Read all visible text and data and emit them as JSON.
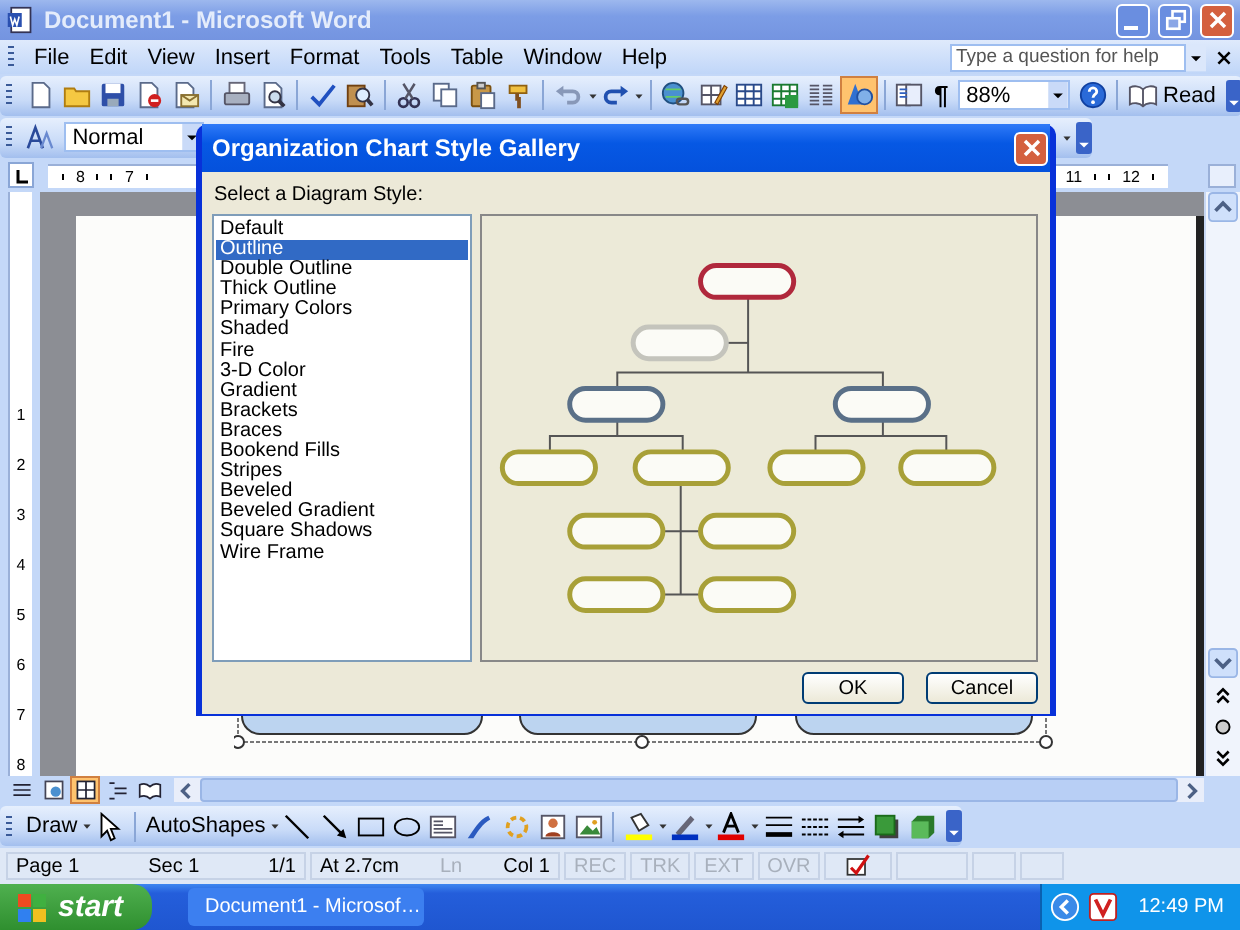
{
  "window": {
    "title": "Document1 - Microsoft Word"
  },
  "menu": [
    "File",
    "Edit",
    "View",
    "Insert",
    "Format",
    "Tools",
    "Table",
    "Window",
    "Help"
  ],
  "help_box": {
    "placeholder": "Type a question for help"
  },
  "standard_toolbar": {
    "drawing_toggle_on": true,
    "show_marks": "¶",
    "zoom": "88%",
    "read_button": "Read"
  },
  "formatting_toolbar": {
    "style": "Normal"
  },
  "horizontal_ruler": {
    "left_labels": [
      "8",
      "7"
    ],
    "right_labels": [
      "11",
      "12"
    ]
  },
  "vertical_ruler": [
    "1",
    "2",
    "3",
    "4",
    "5",
    "6",
    "7",
    "8"
  ],
  "view_buttons": [
    {
      "selected": false
    },
    {
      "selected": false
    },
    {
      "selected": true
    },
    {
      "selected": false
    },
    {
      "selected": false
    }
  ],
  "dialog": {
    "title": "Organization Chart Style Gallery",
    "prompt": "Select a Diagram Style:",
    "styles": [
      {
        "label": "Default",
        "selected": false
      },
      {
        "label": "Outline",
        "selected": true
      },
      {
        "label": "Double Outline",
        "selected": false
      },
      {
        "label": "Thick Outline",
        "selected": false
      },
      {
        "label": "Primary Colors",
        "selected": false
      },
      {
        "label": "Shaded",
        "selected": false
      },
      {
        "label": "Fire",
        "selected": false
      },
      {
        "label": "3-D Color",
        "selected": false
      },
      {
        "label": "Gradient",
        "selected": false
      },
      {
        "label": "Brackets",
        "selected": false
      },
      {
        "label": "Braces",
        "selected": false
      },
      {
        "label": "Bookend Fills",
        "selected": false
      },
      {
        "label": "Stripes",
        "selected": false
      },
      {
        "label": "Beveled",
        "selected": false
      },
      {
        "label": "Beveled Gradient",
        "selected": false
      },
      {
        "label": "Square Shadows",
        "selected": false
      },
      {
        "label": "Wire Frame",
        "selected": false
      }
    ],
    "buttons": [
      "OK",
      "Cancel"
    ]
  },
  "drawing_toolbar": {
    "draw": "Draw",
    "autoshapes": "AutoShapes"
  },
  "status_bar": {
    "sections": [
      {
        "fields": [
          {
            "text": "Page 1",
            "disabled": false
          },
          {
            "text": "Sec 1",
            "disabled": false
          },
          {
            "text": "1/1",
            "disabled": false
          }
        ]
      },
      {
        "fields": [
          {
            "text": "At 2.7cm",
            "disabled": false
          },
          {
            "text": "Ln",
            "disabled": true
          },
          {
            "text": "Col 1",
            "disabled": false
          }
        ]
      },
      {
        "fields": [
          {
            "text": "REC",
            "disabled": true
          }
        ]
      },
      {
        "fields": [
          {
            "text": "TRK",
            "disabled": true
          }
        ]
      },
      {
        "fields": [
          {
            "text": "EXT",
            "disabled": true
          }
        ]
      },
      {
        "fields": [
          {
            "text": "OVR",
            "disabled": true
          }
        ]
      }
    ]
  },
  "taskbar": {
    "start": "start",
    "tasks": [
      "Document1 - Microsof…"
    ],
    "clock": "12:49 PM"
  }
}
